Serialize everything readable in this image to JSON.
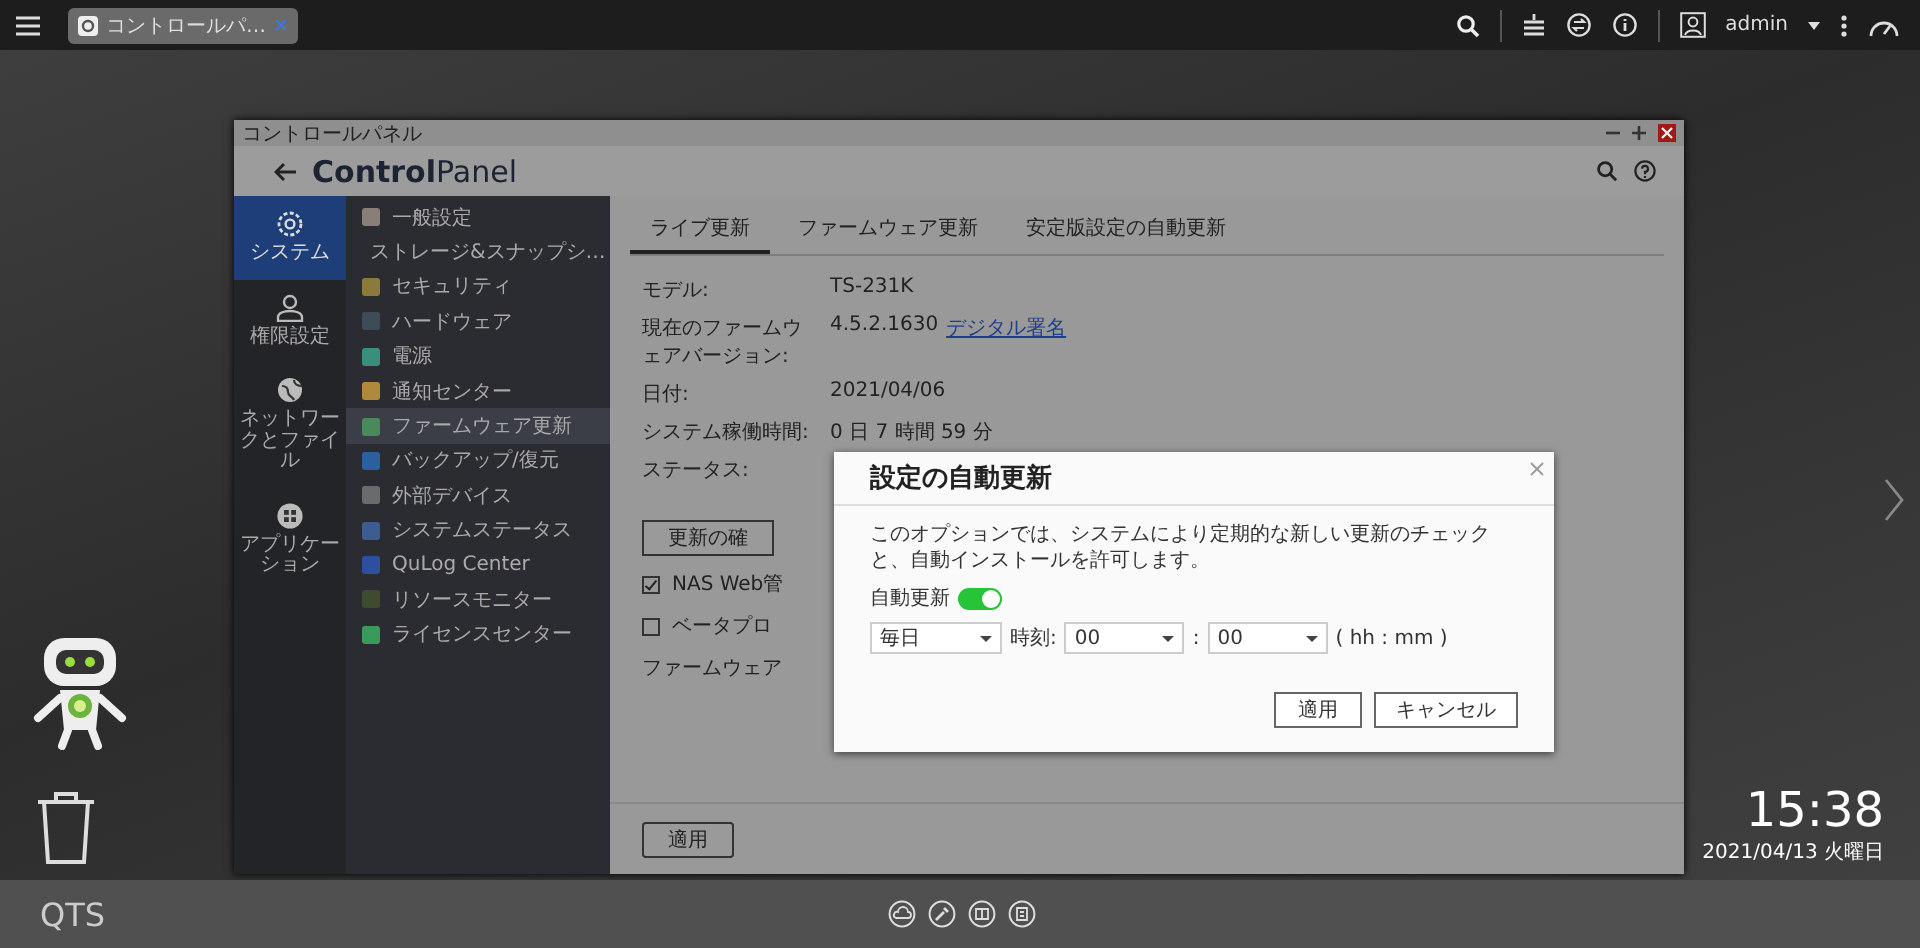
{
  "top_bar": {
    "tabs": [
      {
        "label": "コントロールパ…",
        "selected": true
      }
    ],
    "user": "admin"
  },
  "window": {
    "title": "コントロールパネル",
    "app_title": "**Control**Panel"
  },
  "categories": [
    {
      "label": "システム",
      "selected": true
    },
    {
      "label": "権限設定",
      "selected": false
    },
    {
      "label": "ネットワークとファイル",
      "selected": false
    },
    {
      "label": "アプリケーション",
      "selected": false
    }
  ],
  "menu": [
    {
      "label": "一般設定",
      "selected": false
    },
    {
      "label": "ストレージ&スナップシ…",
      "selected": false
    },
    {
      "label": "セキュリティ",
      "selected": false
    },
    {
      "label": "ハードウェア",
      "selected": false
    },
    {
      "label": "電源",
      "selected": false
    },
    {
      "label": "通知センター",
      "selected": false
    },
    {
      "label": "ファームウェア更新",
      "selected": true
    },
    {
      "label": "バックアップ/復元",
      "selected": false
    },
    {
      "label": "外部デバイス",
      "selected": false
    },
    {
      "label": "システムステータス",
      "selected": false
    },
    {
      "label": "QuLog Center",
      "selected": false
    },
    {
      "label": "リソースモニター",
      "selected": false
    },
    {
      "label": "ライセンスセンター",
      "selected": false
    }
  ],
  "tabs": [
    {
      "label": "ライブ更新",
      "selected": true
    },
    {
      "label": "ファームウェア更新",
      "selected": false
    },
    {
      "label": "安定版設定の自動更新",
      "selected": false
    }
  ],
  "fields": [
    {
      "label": "モデル:",
      "value": "TS-231K"
    },
    {
      "label": "現在のファームウェアバージョン:",
      "value": "4.5.2.1630",
      "link": "デジタル署名"
    },
    {
      "label": "日付:",
      "value": "2021/04/06"
    },
    {
      "label": "システム稼働時間:",
      "value": "0 日 7 時間 59 分"
    },
    {
      "label": "ステータス:"
    }
  ],
  "check_button": "更新の確",
  "options": [
    {
      "label": "NAS Web管",
      "checked": true
    },
    {
      "label": "ベータプロ",
      "checked": false
    }
  ],
  "firmware_label": "ファームウェア",
  "apply_button": "適用",
  "dialog": {
    "title": "設定の自動更新",
    "description": "このオプションでは、システムにより定期的な新しい更新のチェックと、自動インストールを許可します。",
    "auto_update_label": "自動更新",
    "auto_update_on": true,
    "frequency": "毎日",
    "time_label": "時刻:",
    "hour": "00",
    "separator": ":",
    "minute": "00",
    "unit": "( hh : mm )",
    "buttons": [
      "適用",
      "キャンセル"
    ]
  },
  "desktop": {
    "clock": "15:38",
    "date": "2021/04/13 火曜日",
    "brand": "QTS"
  }
}
